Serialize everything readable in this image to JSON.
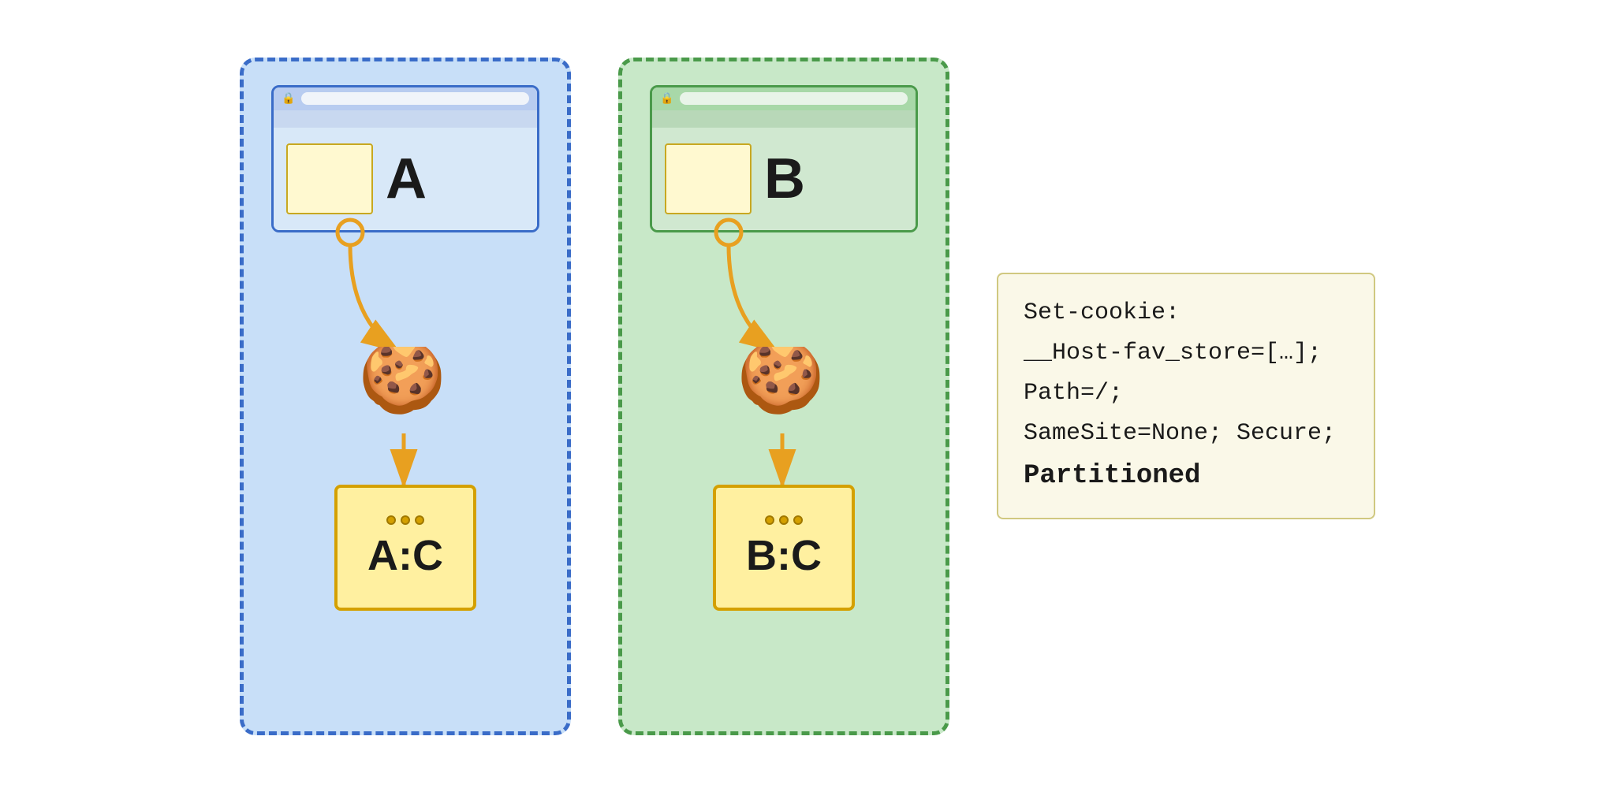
{
  "panels": [
    {
      "id": "panel-a",
      "color": "blue",
      "site_label": "A",
      "storage_label": "A:C",
      "cookie_emoji": "🍪"
    },
    {
      "id": "panel-b",
      "color": "green",
      "site_label": "B",
      "storage_label": "B:C",
      "cookie_emoji": "🍪"
    }
  ],
  "code_box": {
    "lines": [
      "Set-cookie:",
      "__Host-fav_store=[…];",
      "Path=/;",
      "SameSite=None; Secure;",
      "Partitioned"
    ]
  },
  "icons": {
    "lock": "🔒"
  }
}
